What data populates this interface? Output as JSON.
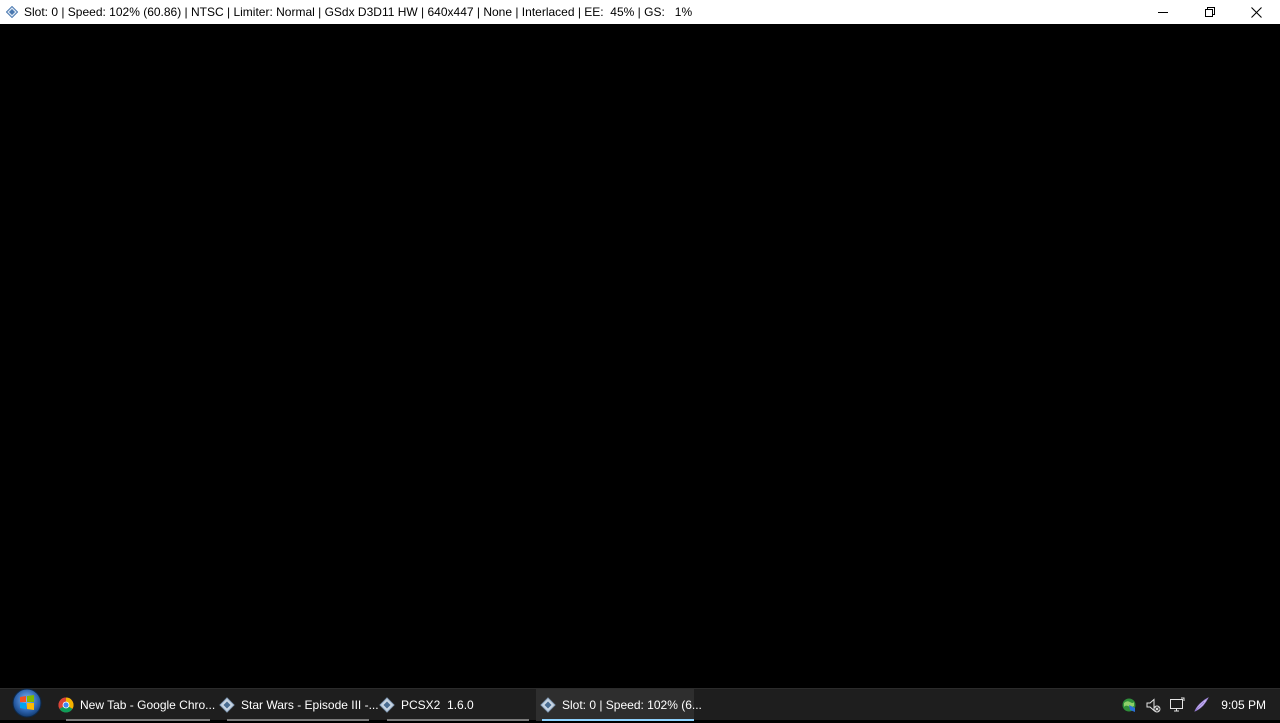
{
  "window": {
    "title": "Slot: 0 | Speed: 102% (60.86) | NTSC | Limiter: Normal | GSdx D3D11 HW | 640x447 | None | Interlaced | EE:  45% | GS:   1%",
    "icon": "pcsx2-icon",
    "controls": [
      "minimize-icon",
      "restore-icon",
      "close-icon"
    ]
  },
  "taskbar": {
    "start_icon": "windows-start-icon",
    "items": [
      {
        "label": "New Tab - Google Chro...",
        "icon": "chrome-icon",
        "active": false
      },
      {
        "label": "Star Wars - Episode III -...",
        "icon": "pcsx2-icon",
        "active": false
      },
      {
        "label": "PCSX2  1.6.0",
        "icon": "pcsx2-icon",
        "active": false
      },
      {
        "label": "Slot: 0 | Speed: 102% (6...",
        "icon": "pcsx2-icon",
        "active": true
      }
    ],
    "tray_icons": [
      "network-globe-icon",
      "volume-muted-icon",
      "action-center-icon",
      "pen-icon"
    ],
    "clock": "9:05 PM"
  },
  "colors": {
    "viewport": "#000000",
    "taskbar": "#1e1e1e",
    "active_underline": "#8fd3ff"
  }
}
